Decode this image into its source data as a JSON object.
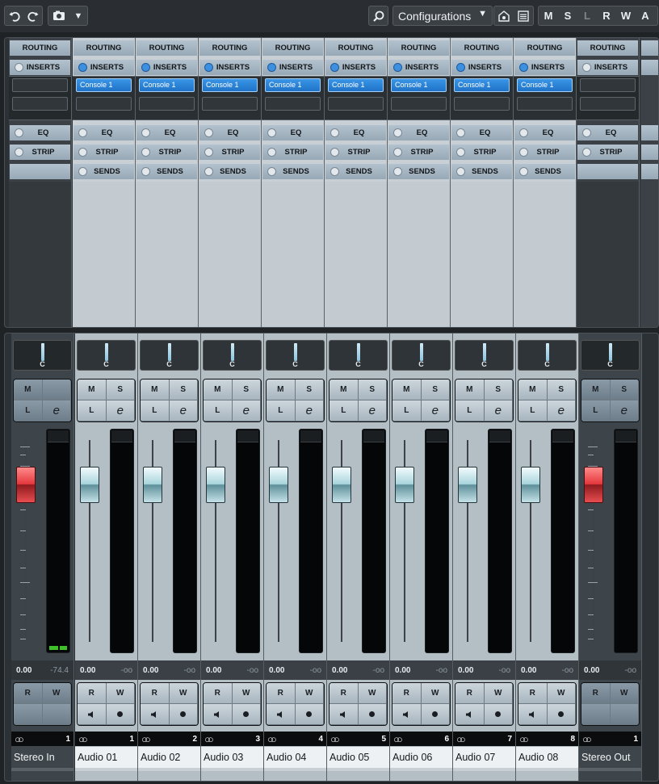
{
  "toolbar": {
    "undo_icon": "undo-icon",
    "redo_icon": "redo-icon",
    "snapshot_icon": "camera-icon",
    "search_icon": "search-icon",
    "configurations_label": "Configurations",
    "state_buttons": [
      "M",
      "S",
      "L",
      "R",
      "W",
      "A"
    ]
  },
  "rack": {
    "routing_label": "ROUTING",
    "inserts_label": "INSERTS",
    "eq_label": "EQ",
    "strip_label": "STRIP",
    "sends_label": "SENDS",
    "insert_plugin": "Console 1"
  },
  "channels": [
    {
      "name": "Stereo In",
      "number": "1",
      "pan": "C",
      "level": "0.00",
      "peak": "-74.4",
      "type": "input"
    },
    {
      "name": "Audio 01",
      "number": "1",
      "pan": "C",
      "level": "0.00",
      "peak": "-oo",
      "type": "audio"
    },
    {
      "name": "Audio 02",
      "number": "2",
      "pan": "C",
      "level": "0.00",
      "peak": "-oo",
      "type": "audio"
    },
    {
      "name": "Audio 03",
      "number": "3",
      "pan": "C",
      "level": "0.00",
      "peak": "-oo",
      "type": "audio"
    },
    {
      "name": "Audio 04",
      "number": "4",
      "pan": "C",
      "level": "0.00",
      "peak": "-oo",
      "type": "audio"
    },
    {
      "name": "Audio 05",
      "number": "5",
      "pan": "C",
      "level": "0.00",
      "peak": "-oo",
      "type": "audio"
    },
    {
      "name": "Audio 06",
      "number": "6",
      "pan": "C",
      "level": "0.00",
      "peak": "-oo",
      "type": "audio"
    },
    {
      "name": "Audio 07",
      "number": "7",
      "pan": "C",
      "level": "0.00",
      "peak": "-oo",
      "type": "audio"
    },
    {
      "name": "Audio 08",
      "number": "8",
      "pan": "C",
      "level": "0.00",
      "peak": "-oo",
      "type": "audio"
    },
    {
      "name": "Stereo Out",
      "number": "1",
      "pan": "C",
      "level": "0.00",
      "peak": "-oo",
      "type": "output"
    }
  ],
  "strip_buttons": {
    "mute": "M",
    "solo": "S",
    "listen": "L",
    "edit": "e",
    "read": "R",
    "write": "W"
  },
  "colors": {
    "accent_blue": "#2b86d9",
    "fader_red": "#e4373c",
    "fader_cyan": "#a8d4dc",
    "meter_green": "#3fbf2a"
  }
}
